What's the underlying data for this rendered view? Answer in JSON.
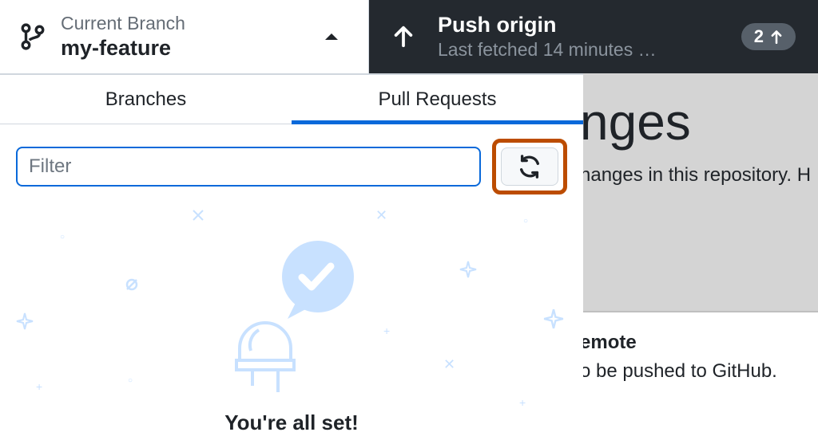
{
  "toolbar": {
    "branch": {
      "label": "Current Branch",
      "name": "my-feature"
    },
    "push": {
      "title": "Push origin",
      "subtitle": "Last fetched 14 minutes …",
      "badge_count": "2"
    }
  },
  "panel": {
    "tabs": {
      "branches": "Branches",
      "pull_requests": "Pull Requests"
    },
    "filter_placeholder": "Filter",
    "empty_message": "You're all set!"
  },
  "background": {
    "heading_fragment": "nges",
    "para_fragment": "nanges in this repository. H",
    "sub_heading_fragment": "emote",
    "sub_para_fragment": "o be pushed to GitHub."
  }
}
